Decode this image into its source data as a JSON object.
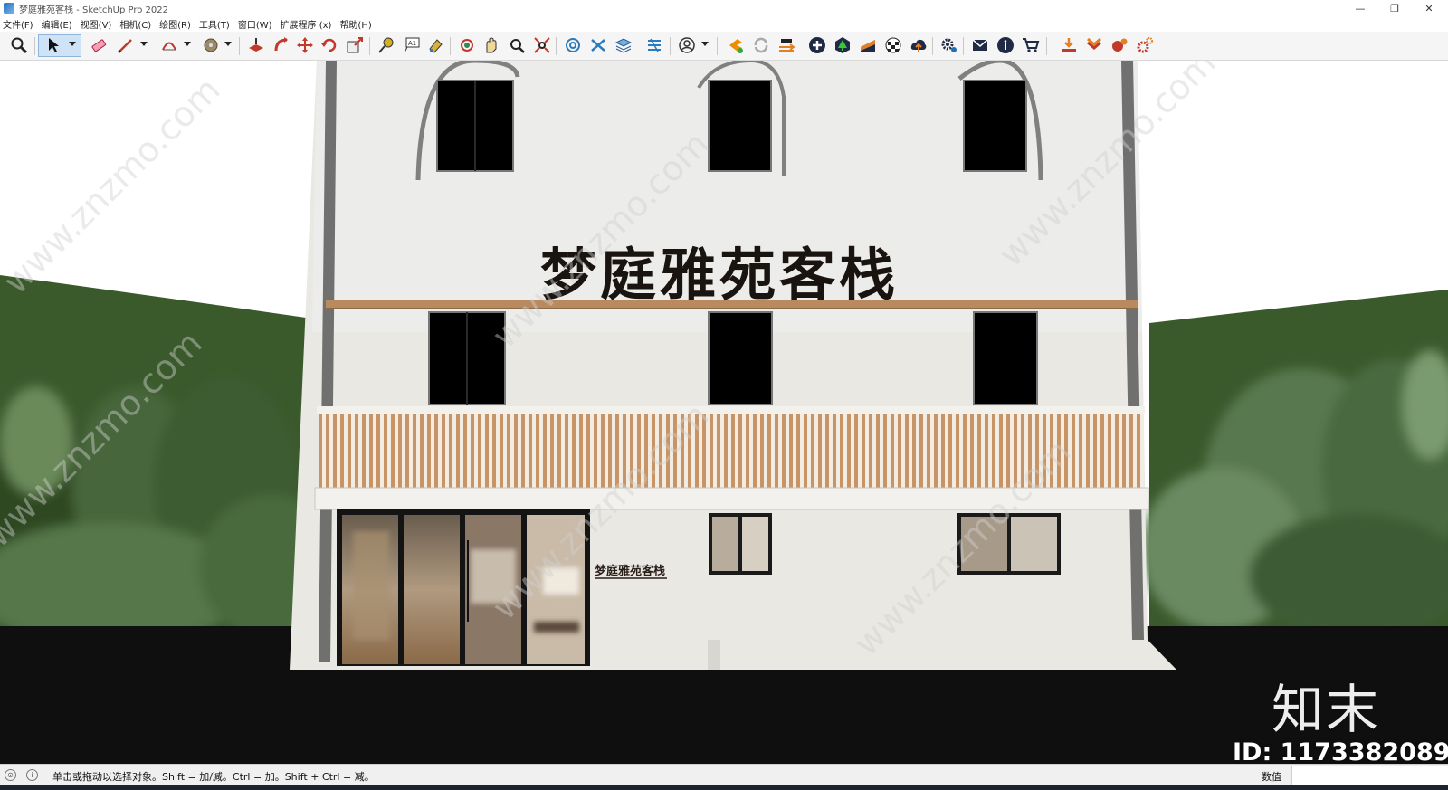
{
  "window": {
    "title": "梦庭雅苑客栈 - SketchUp Pro 2022",
    "minimize": "—",
    "restore": "❐",
    "close": "✕"
  },
  "menu": [
    "文件(F)",
    "编辑(E)",
    "视图(V)",
    "相机(C)",
    "绘图(R)",
    "工具(T)",
    "窗口(W)",
    "扩展程序 (x)",
    "帮助(H)"
  ],
  "toolbar_icons": [
    "zoom-icon",
    "select-arrow-icon",
    "eraser-icon",
    "pencil-line-icon",
    "arc-icon",
    "paint-bucket-icon",
    "push-pull-icon",
    "follow-me-icon",
    "move-icon",
    "rotate-icon",
    "scale-icon",
    "tape-measure-icon",
    "text-icon",
    "paint-icon",
    "orbit-icon",
    "pan-icon",
    "zoom-window-icon",
    "zoom-extents-icon",
    "warehouse-icon",
    "extension-icon",
    "layers-icon",
    "sandbox-icon",
    "user-account-icon",
    "plugin-orange-icon",
    "refresh-icon",
    "swap-icon",
    "add-circle-icon",
    "tree-icon",
    "stripes-icon",
    "checker-icon",
    "cloud-upload-icon",
    "gear-icon",
    "mail-icon",
    "info-icon",
    "cart-icon",
    "download-icon",
    "chevron-red-icon",
    "tools-red-icon",
    "gears-red-icon"
  ],
  "scene": {
    "sign_main": "梦庭雅苑客栈",
    "sign_small": "梦庭雅苑客栈",
    "watermark_text": "www.znzmo.com",
    "colors": {
      "facade": "#ededea",
      "wood": "#c89a6c",
      "hill": "#3a5a2c",
      "ground": "#0f0f0f",
      "window": "#000000"
    }
  },
  "status": {
    "hint": "单击或拖动以选择对象。Shift = 加/减。Ctrl = 加。Shift + Ctrl = 减。",
    "measurements_label": "数值"
  },
  "watermark": {
    "logo": "知末",
    "id": "ID: 1173382089"
  }
}
